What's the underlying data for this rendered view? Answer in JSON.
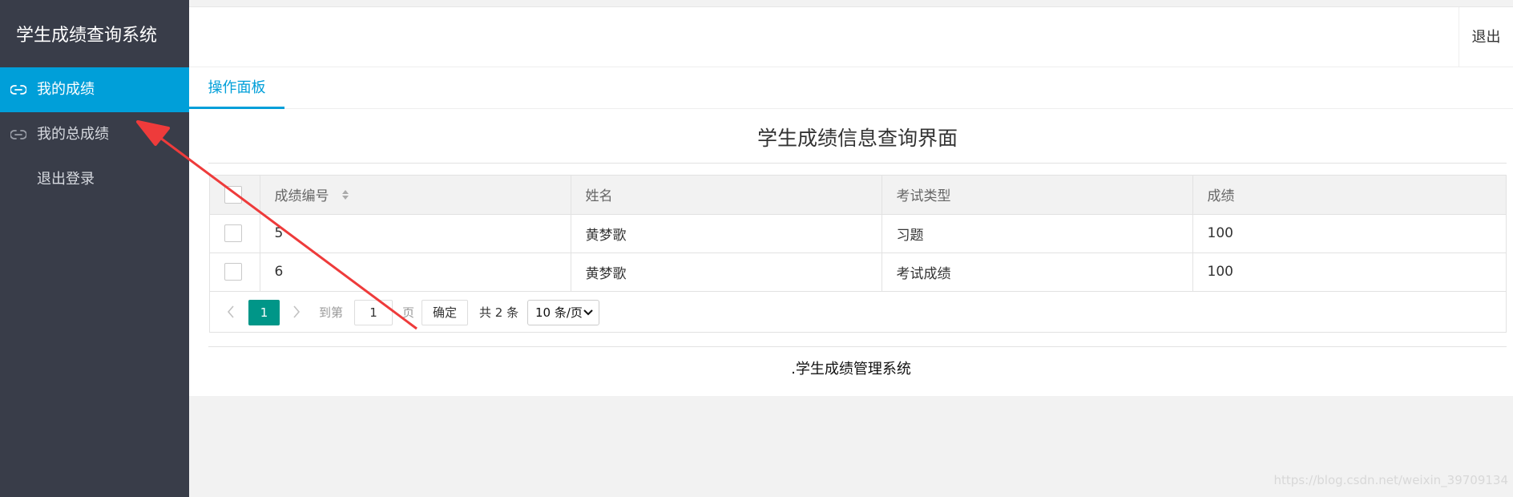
{
  "sidebar": {
    "title": "学生成绩查询系统",
    "items": [
      {
        "label": "我的成绩",
        "icon": "link-icon",
        "active": true
      },
      {
        "label": "我的总成绩",
        "icon": "link-icon",
        "active": false
      },
      {
        "label": "退出登录",
        "icon": null,
        "active": false
      }
    ]
  },
  "header": {
    "logout_label": "退出"
  },
  "tabs": [
    {
      "label": "操作面板",
      "active": true
    }
  ],
  "main": {
    "title": "学生成绩信息查询界面"
  },
  "table": {
    "columns": [
      "成绩编号",
      "姓名",
      "考试类型",
      "成绩"
    ],
    "rows": [
      [
        "5",
        "黄梦歌",
        "习题",
        "100"
      ],
      [
        "6",
        "黄梦歌",
        "考试成绩",
        "100"
      ]
    ]
  },
  "pagination": {
    "current_page": "1",
    "goto_label": "到第",
    "goto_value": "1",
    "page_label": "页",
    "confirm_label": "确定",
    "total_label": "共 2 条",
    "page_size": "10 条/页"
  },
  "footer": {
    "text": ".学生成绩管理系统"
  },
  "watermark": "https://blog.csdn.net/weixin_39709134",
  "colors": {
    "sidebar_bg": "#393d49",
    "accent": "#009fd9",
    "pager_active": "#009688",
    "arrow": "#ee3b3b"
  }
}
